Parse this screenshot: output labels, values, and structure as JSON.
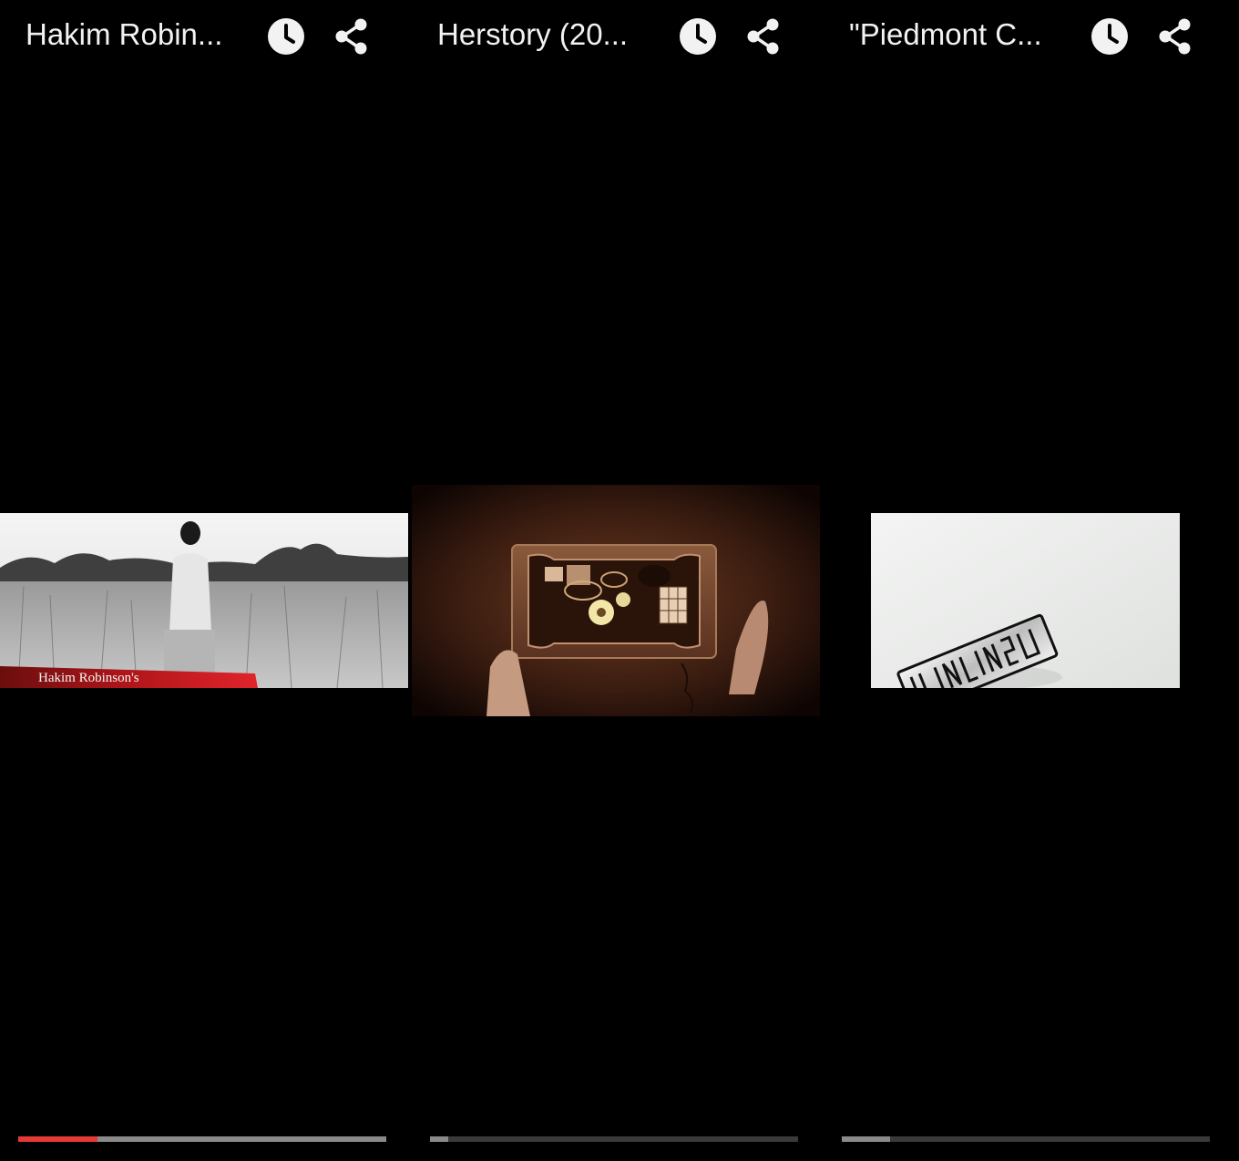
{
  "colors": {
    "background": "#000000",
    "title_text": "#f2f2f2",
    "icon": "#f2f2f2",
    "progress_played": "#e53935",
    "progress_buffered": "#8a8a8a",
    "progress_track": "#3a3a3a"
  },
  "panels": [
    {
      "title": "Hakim Robin...",
      "watch_later_icon": "clock-icon",
      "share_icon": "share-icon",
      "thumbnail": {
        "scene": "black-and-white field with red title banner",
        "banner_text": "Hakim Robinson's"
      },
      "progress": {
        "played_fraction": 0.215,
        "buffered_fraction": 1.0
      }
    },
    {
      "title": "Herstory (20...",
      "watch_later_icon": "clock-icon",
      "share_icon": "share-icon",
      "thumbnail": {
        "scene": "sepia wooden jewelry box held by hands"
      },
      "progress": {
        "played_fraction": 0.0,
        "buffered_fraction": 0.05
      }
    },
    {
      "title": "\"Piedmont C...",
      "watch_later_icon": "clock-icon",
      "share_icon": "share-icon",
      "thumbnail": {
        "scene": "white background with metal card"
      },
      "progress": {
        "played_fraction": 0.0,
        "buffered_fraction": 0.13
      }
    }
  ]
}
